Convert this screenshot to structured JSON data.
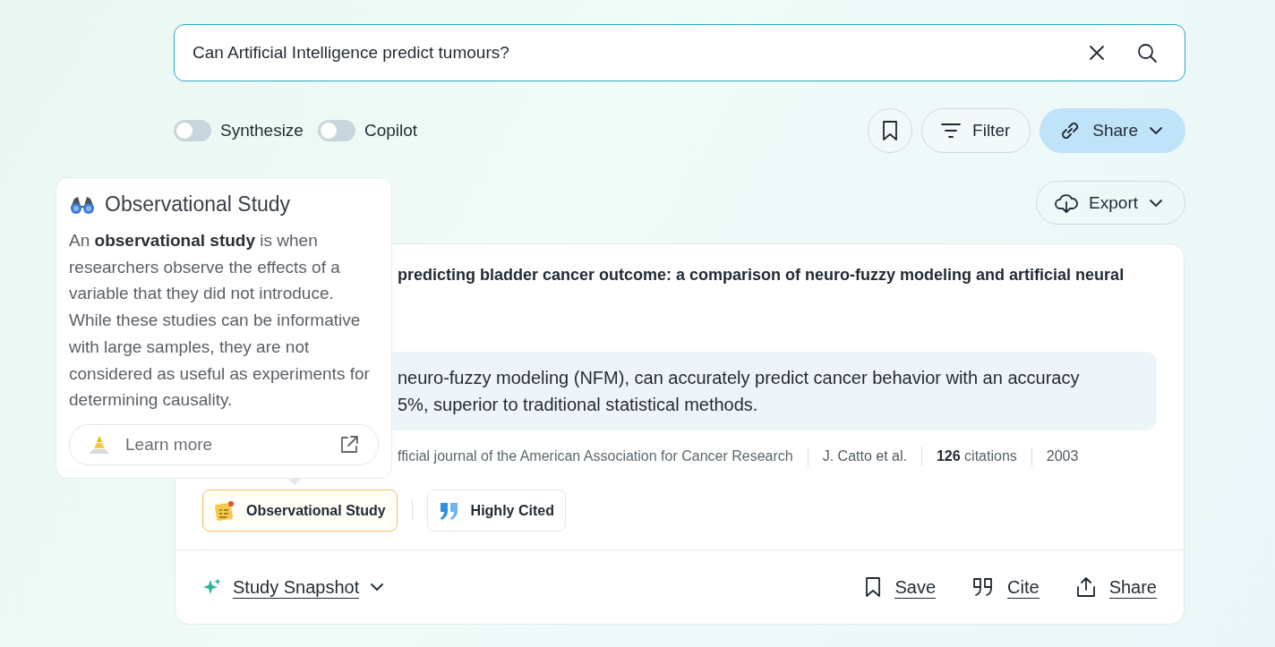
{
  "search": {
    "value": "Can Artificial Intelligence predict tumours?"
  },
  "toggles": [
    {
      "label": "Synthesize",
      "on": false
    },
    {
      "label": "Copilot",
      "on": false
    }
  ],
  "toolbar": {
    "filter": "Filter",
    "share": "Share",
    "export": "Export"
  },
  "popover": {
    "title": "Observational Study",
    "text": "An **observational study** is when researchers observe the effects of a variable that they did not introduce. While these studies can be informative with large samples, they are not considered as useful as experiments for determining causality.",
    "link": "Learn more"
  },
  "result": {
    "title": "predicting bladder cancer outcome: a comparison of neuro-fuzzy modeling and artificial neural",
    "abstract_lines": [
      "neuro-fuzzy modeling (NFM), can accurately predict cancer behavior with an accuracy",
      "5%, superior to traditional statistical methods."
    ],
    "meta": [
      {
        "kind": "journal",
        "text": "fficial journal of the American Association for Cancer Research"
      },
      {
        "kind": "authors",
        "text": "J. Catto et al."
      },
      {
        "kind": "citations",
        "text": "**126** citations"
      },
      {
        "kind": "year",
        "text": "2003"
      }
    ],
    "tags": [
      {
        "kind": "study",
        "label": "Observational Study",
        "selected": true
      },
      {
        "kind": "cited",
        "label": "Highly Cited",
        "selected": false
      }
    ],
    "snapshot": "Study Snapshot",
    "actions": [
      {
        "kind": "save",
        "label": "Save"
      },
      {
        "kind": "cite",
        "label": "Cite"
      },
      {
        "kind": "share",
        "label": "Share"
      }
    ]
  }
}
